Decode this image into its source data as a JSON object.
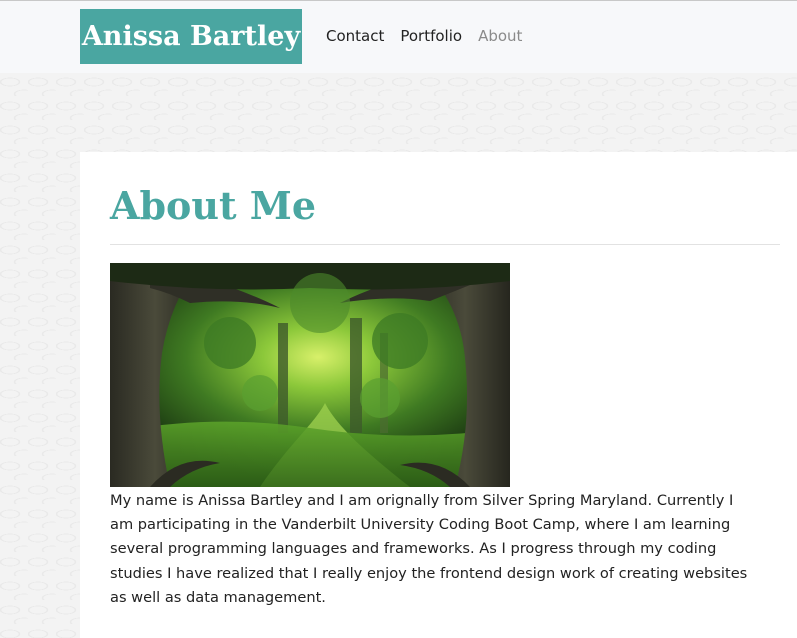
{
  "header": {
    "brand": "Anissa Bartley",
    "nav": [
      {
        "label": "Contact"
      },
      {
        "label": "Portfolio"
      },
      {
        "label": "About"
      }
    ],
    "active_nav": "About"
  },
  "main": {
    "title": "About Me",
    "image_subject": "forest",
    "bio": "My name is Anissa Bartley and I am orignally from Silver Spring Maryland. Currently I am participating in the Vanderbilt University Coding Boot Camp, where I am learning several programming languages and frameworks. As I progress through my coding studies I have realized that I really enjoy the frontend design work of creating websites as well as data management."
  },
  "colors": {
    "accent": "#4aa6a1",
    "nav_active": "#8a8a8a"
  }
}
